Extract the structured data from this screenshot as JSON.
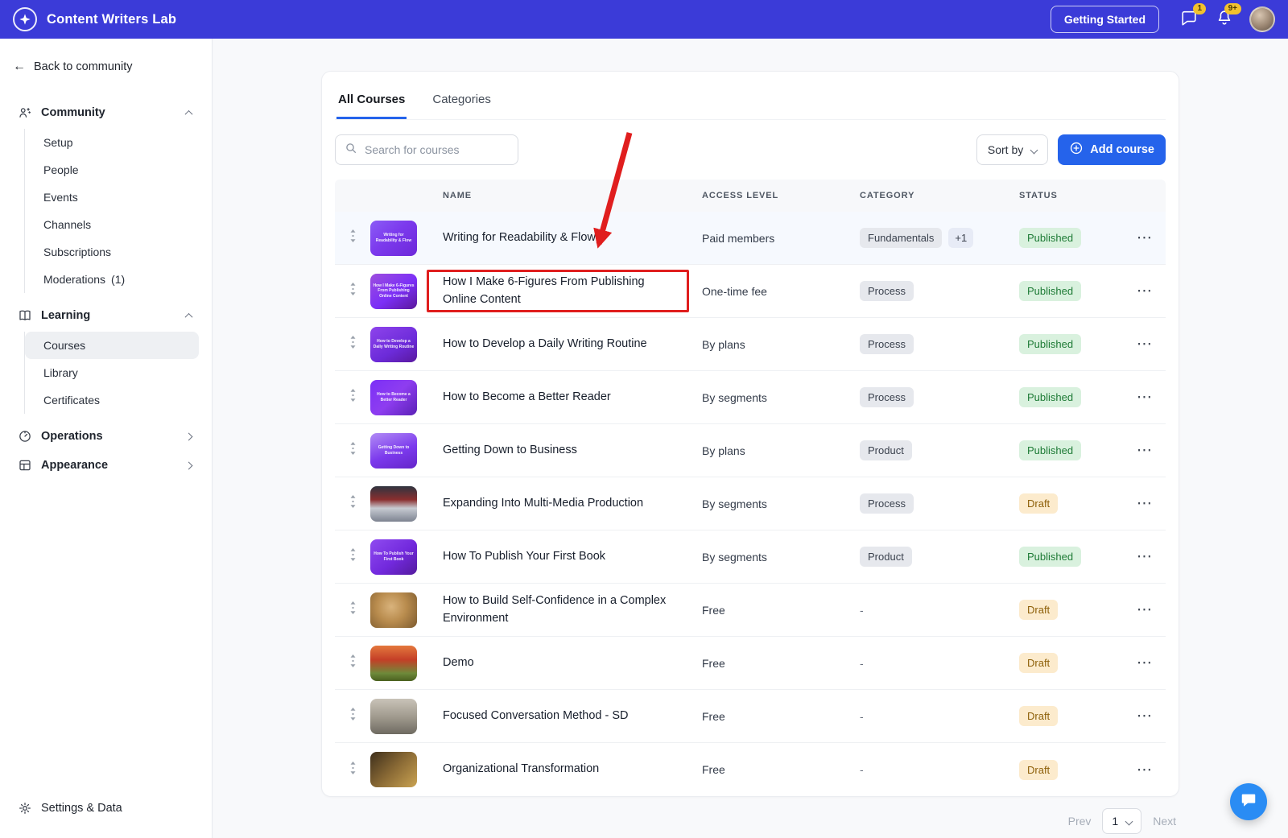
{
  "colors": {
    "topbar-bg": "#3b3bd8",
    "accent": "#2563eb",
    "published-bg": "#d9f1de",
    "published-text": "#1e7b36",
    "draft-bg": "#fcebcd",
    "draft-text": "#8d5f08",
    "badge-bg": "#e6e8ed",
    "annotation-red": "#e01e1e",
    "notif-yellow": "#f2c12e",
    "chat-bubble": "#2a8cf4"
  },
  "topbar": {
    "app_title": "Content Writers Lab",
    "getting_started_label": "Getting Started",
    "messages_badge": "1",
    "notifications_badge": "9+"
  },
  "sidebar": {
    "back_label": "Back to community",
    "community": {
      "label": "Community",
      "items": [
        {
          "label": "Setup"
        },
        {
          "label": "People"
        },
        {
          "label": "Events"
        },
        {
          "label": "Channels"
        },
        {
          "label": "Subscriptions"
        },
        {
          "label": "Moderations",
          "count": "(1)"
        }
      ]
    },
    "learning": {
      "label": "Learning",
      "items": [
        {
          "label": "Courses",
          "active": true
        },
        {
          "label": "Library"
        },
        {
          "label": "Certificates"
        }
      ]
    },
    "operations_label": "Operations",
    "appearance_label": "Appearance",
    "settings_label": "Settings & Data"
  },
  "main": {
    "tabs": [
      {
        "label": "All Courses",
        "active": true
      },
      {
        "label": "Categories"
      }
    ],
    "search_placeholder": "Search for courses",
    "sort_label": "Sort by",
    "add_course_label": "Add course",
    "table": {
      "columns": [
        "NAME",
        "ACCESS LEVEL",
        "CATEGORY",
        "STATUS"
      ],
      "empty_category": "-",
      "rows": [
        {
          "name": "Writing for Readability & Flow",
          "access": "Paid members",
          "category": "Fundamentals",
          "category_extra": "+1",
          "status": "Published",
          "thumb": "cover-readability",
          "hover": true
        },
        {
          "name": "How I Make 6-Figures From Publishing Online Content",
          "access": "One-time fee",
          "category": "Process",
          "status": "Published",
          "thumb": "cover-sixfigures",
          "annotated": true
        },
        {
          "name": "How to Develop a Daily Writing Routine",
          "access": "By plans",
          "category": "Process",
          "status": "Published",
          "thumb": "cover-routine"
        },
        {
          "name": "How to Become a Better Reader",
          "access": "By segments",
          "category": "Process",
          "status": "Published",
          "thumb": "cover-reader"
        },
        {
          "name": "Getting Down to Business",
          "access": "By plans",
          "category": "Product",
          "status": "Published",
          "thumb": "cover-business"
        },
        {
          "name": "Expanding Into Multi-Media Production",
          "access": "By segments",
          "category": "Process",
          "status": "Draft",
          "thumb": "photo-clapperboard"
        },
        {
          "name": "How To Publish Your First Book",
          "access": "By segments",
          "category": "Product",
          "status": "Published",
          "thumb": "cover-book"
        },
        {
          "name": "How to Build Self-Confidence in a Complex Environment",
          "access": "Free",
          "category": "",
          "status": "Draft",
          "thumb": "photo-lion"
        },
        {
          "name": "Demo",
          "access": "Free",
          "category": "",
          "status": "Draft",
          "thumb": "photo-poppies"
        },
        {
          "name": "Focused Conversation Method - SD",
          "access": "Free",
          "category": "",
          "status": "Draft",
          "thumb": "photo-desk"
        },
        {
          "name": "Organizational Transformation",
          "access": "Free",
          "category": "",
          "status": "Draft",
          "thumb": "photo-gavel"
        }
      ]
    },
    "pagination": {
      "prev_label": "Prev",
      "page_value": "1",
      "next_label": "Next"
    }
  }
}
